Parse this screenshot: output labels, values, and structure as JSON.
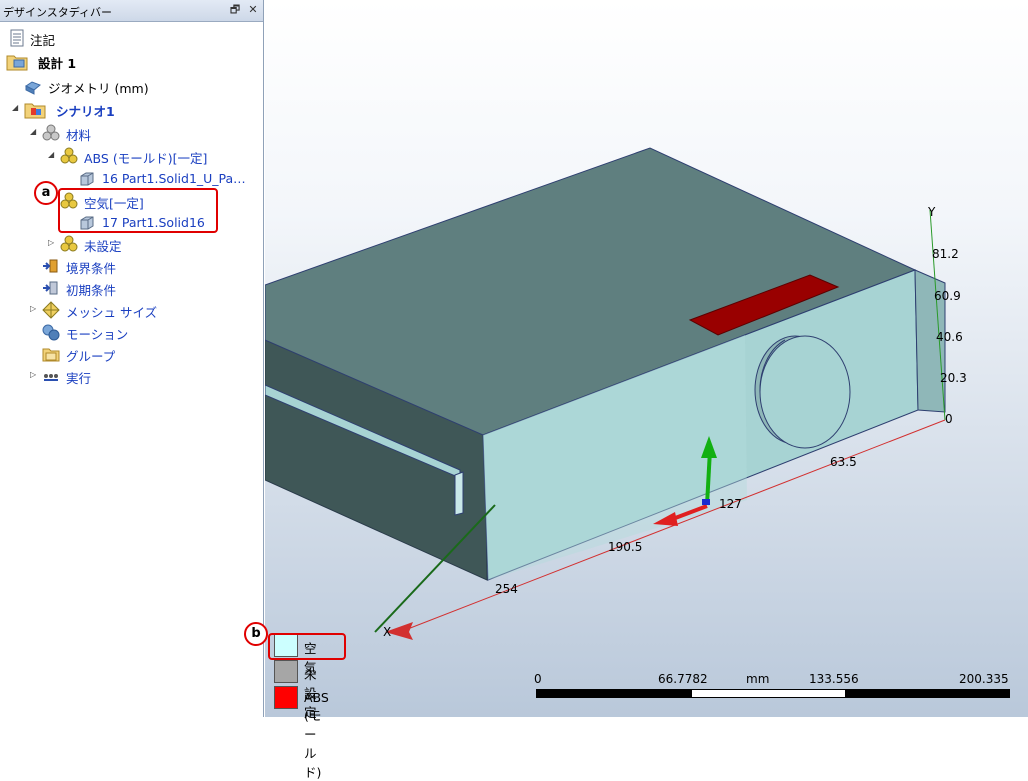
{
  "panel": {
    "title": "デザインスタディバー",
    "float_button": "🗗",
    "close_button": "✕"
  },
  "tree": {
    "notes": "注記",
    "design": "設計 1",
    "geometry": "ジオメトリ (mm)",
    "scenario": "シナリオ1",
    "materials": "材料",
    "abs": "ABS (モールド)[一定]",
    "abs_part": "16 Part1.Solid1_U_Pa…",
    "air": "空気[一定]",
    "air_part": "17 Part1.Solid16",
    "unset": "未設定",
    "boundary": "境界条件",
    "initial": "初期条件",
    "mesh": "メッシュ サイズ",
    "motion": "モーション",
    "groups": "グループ",
    "run": "実行"
  },
  "callouts": {
    "a": "a",
    "b": "b"
  },
  "viewport": {
    "y_axis": {
      "label": "Y",
      "ticks": [
        "81.2",
        "60.9",
        "40.6",
        "20.3",
        "0"
      ]
    },
    "x_axis": {
      "label": "X",
      "ticks": [
        "63.5",
        "127",
        "190.5",
        "254"
      ]
    }
  },
  "legend": [
    {
      "label": "空気",
      "color": "#ccffff"
    },
    {
      "label": "未設定",
      "color": "#a6a6a6"
    },
    {
      "label": "ABS (モールド)",
      "color": "#ff0000"
    }
  ],
  "scale_bar": {
    "ticks": [
      "0",
      "66.7782",
      "133.556",
      "200.335"
    ],
    "unit": "mm"
  },
  "colors": {
    "model_top": "#5f7f7f",
    "model_front": "#a7d3d3",
    "model_side": "#8fb7b8",
    "model_left": "#3f5757",
    "vent": "#990000",
    "highlight": "#e00000",
    "tree_link": "#1a3fc0"
  }
}
